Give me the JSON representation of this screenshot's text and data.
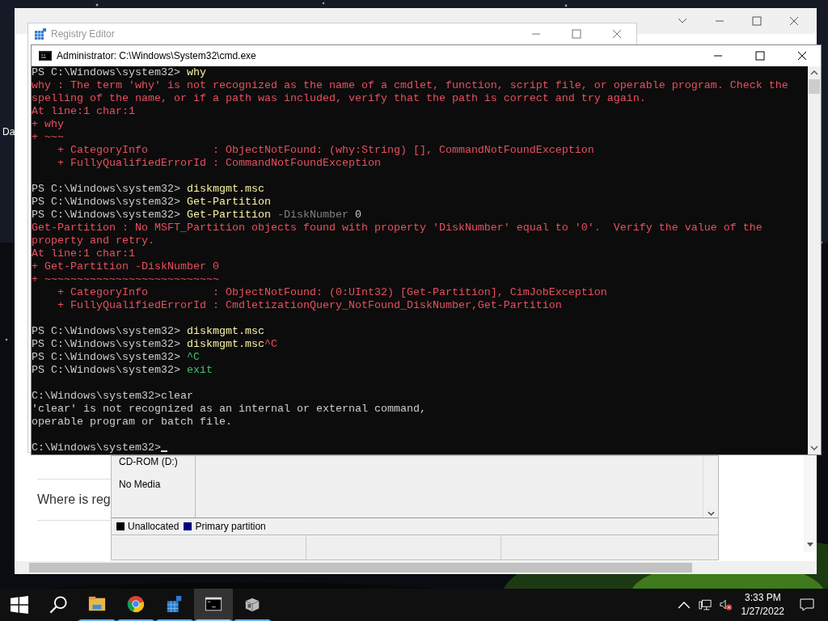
{
  "desktop": {
    "icon_label": "Da"
  },
  "browser_window": {
    "headings": [
      "Where is reg"
    ]
  },
  "registry_editor": {
    "title": "Registry Editor"
  },
  "disk_management": {
    "volume": "CD-ROM (D:)",
    "status": "No Media",
    "legend": [
      {
        "label": "Unallocated",
        "color": "#000000"
      },
      {
        "label": "Primary partition",
        "color": "#00007f"
      }
    ]
  },
  "console": {
    "title": "Administrator: C:\\Windows\\System32\\cmd.exe",
    "lines": [
      {
        "kind": "text",
        "segments": [
          {
            "kind": "prompt",
            "text": "PS C:\\Windows\\system32> "
          },
          {
            "kind": "command",
            "text": "why"
          }
        ]
      },
      {
        "kind": "text",
        "segments": [
          {
            "kind": "error",
            "text": "why : The term 'why' is not recognized as the name of a cmdlet, function, script file, or operable program. Check the"
          }
        ]
      },
      {
        "kind": "text",
        "segments": [
          {
            "kind": "error",
            "text": "spelling of the name, or if a path was included, verify that the path is correct and try again."
          }
        ]
      },
      {
        "kind": "text",
        "segments": [
          {
            "kind": "error",
            "text": "At line:1 char:1"
          }
        ]
      },
      {
        "kind": "text",
        "segments": [
          {
            "kind": "error",
            "text": "+ why"
          }
        ]
      },
      {
        "kind": "text",
        "segments": [
          {
            "kind": "error",
            "text": "+ ~~~"
          }
        ]
      },
      {
        "kind": "text",
        "segments": [
          {
            "kind": "error",
            "text": "    + CategoryInfo          : ObjectNotFound: (why:String) [], CommandNotFoundException"
          }
        ]
      },
      {
        "kind": "text",
        "segments": [
          {
            "kind": "error",
            "text": "    + FullyQualifiedErrorId : CommandNotFoundException"
          }
        ]
      },
      {
        "kind": "blank"
      },
      {
        "kind": "text",
        "segments": [
          {
            "kind": "prompt",
            "text": "PS C:\\Windows\\system32> "
          },
          {
            "kind": "command",
            "text": "diskmgmt.msc"
          }
        ]
      },
      {
        "kind": "text",
        "segments": [
          {
            "kind": "prompt",
            "text": "PS C:\\Windows\\system32> "
          },
          {
            "kind": "command",
            "text": "Get-Partition"
          }
        ]
      },
      {
        "kind": "text",
        "segments": [
          {
            "kind": "prompt",
            "text": "PS C:\\Windows\\system32> "
          },
          {
            "kind": "command",
            "text": "Get-Partition "
          },
          {
            "kind": "parameter",
            "text": "-DiskNumber "
          },
          {
            "kind": "plain",
            "text": "0"
          }
        ]
      },
      {
        "kind": "text",
        "segments": [
          {
            "kind": "error",
            "text": "Get-Partition : No MSFT_Partition objects found with property 'DiskNumber' equal to '0'.  Verify the value of the"
          }
        ]
      },
      {
        "kind": "text",
        "segments": [
          {
            "kind": "error",
            "text": "property and retry."
          }
        ]
      },
      {
        "kind": "text",
        "segments": [
          {
            "kind": "error",
            "text": "At line:1 char:1"
          }
        ]
      },
      {
        "kind": "text",
        "segments": [
          {
            "kind": "error",
            "text": "+ Get-Partition -DiskNumber 0"
          }
        ]
      },
      {
        "kind": "text",
        "segments": [
          {
            "kind": "error",
            "text": "+ ~~~~~~~~~~~~~~~~~~~~~~~~~~~"
          }
        ]
      },
      {
        "kind": "text",
        "segments": [
          {
            "kind": "error",
            "text": "    + CategoryInfo          : ObjectNotFound: (0:UInt32) [Get-Partition], CimJobException"
          }
        ]
      },
      {
        "kind": "text",
        "segments": [
          {
            "kind": "error",
            "text": "    + FullyQualifiedErrorId : CmdletizationQuery_NotFound_DiskNumber,Get-Partition"
          }
        ]
      },
      {
        "kind": "blank"
      },
      {
        "kind": "text",
        "segments": [
          {
            "kind": "prompt",
            "text": "PS C:\\Windows\\system32> "
          },
          {
            "kind": "command",
            "text": "diskmgmt.msc"
          }
        ]
      },
      {
        "kind": "text",
        "segments": [
          {
            "kind": "prompt",
            "text": "PS C:\\Windows\\system32> "
          },
          {
            "kind": "command",
            "text": "diskmgmt.msc"
          },
          {
            "kind": "error",
            "text": "^C"
          }
        ]
      },
      {
        "kind": "text",
        "segments": [
          {
            "kind": "prompt",
            "text": "PS C:\\Windows\\system32> "
          },
          {
            "kind": "success",
            "text": "^C"
          }
        ]
      },
      {
        "kind": "text",
        "segments": [
          {
            "kind": "prompt",
            "text": "PS C:\\Windows\\system32> "
          },
          {
            "kind": "success",
            "text": "exit"
          }
        ]
      },
      {
        "kind": "blank"
      },
      {
        "kind": "text",
        "segments": [
          {
            "kind": "plain",
            "text": "C:\\Windows\\system32>clear"
          }
        ]
      },
      {
        "kind": "text",
        "segments": [
          {
            "kind": "plain",
            "text": "'clear' is not recognized as an internal or external command,"
          }
        ]
      },
      {
        "kind": "text",
        "segments": [
          {
            "kind": "plain",
            "text": "operable program or batch file."
          }
        ]
      },
      {
        "kind": "blank"
      },
      {
        "kind": "text",
        "cursor": true,
        "segments": [
          {
            "kind": "plain",
            "text": "C:\\Windows\\system32>"
          }
        ]
      }
    ]
  },
  "taskbar": {
    "apps": [
      {
        "kind": "folder",
        "selected": false
      },
      {
        "kind": "browser",
        "selected": false
      },
      {
        "kind": "registry",
        "selected": false
      },
      {
        "kind": "console",
        "selected": true
      },
      {
        "kind": "package",
        "selected": false
      }
    ],
    "time": "3:33 PM",
    "date": "1/27/2022"
  }
}
